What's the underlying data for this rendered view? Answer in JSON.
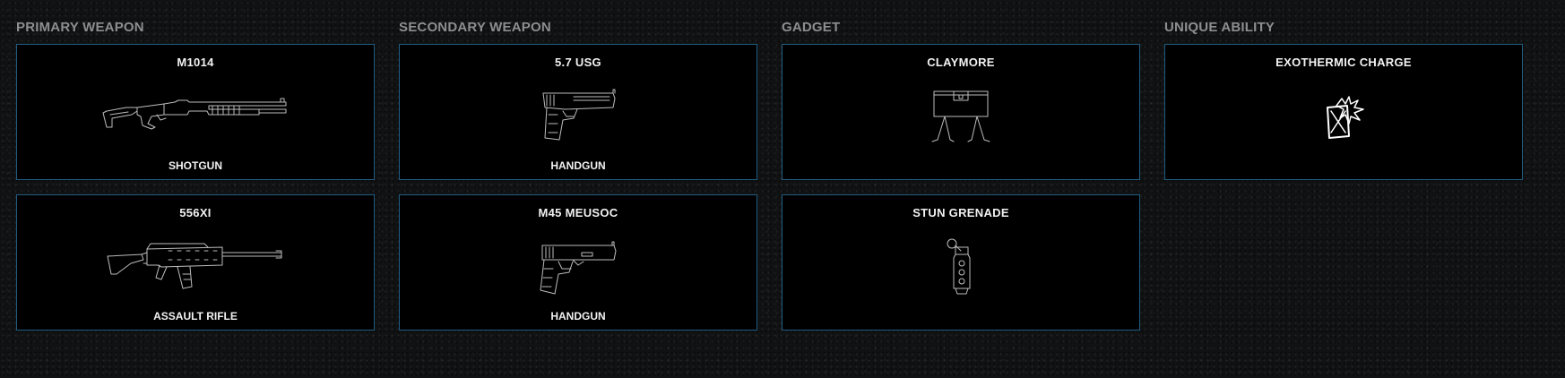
{
  "columns": {
    "primary": {
      "header": "PRIMARY WEAPON",
      "items": [
        {
          "name": "M1014",
          "type": "SHOTGUN",
          "icon": "shotgun-icon"
        },
        {
          "name": "556XI",
          "type": "ASSAULT RIFLE",
          "icon": "assault-rifle-icon"
        }
      ]
    },
    "secondary": {
      "header": "SECONDARY WEAPON",
      "items": [
        {
          "name": "5.7 USG",
          "type": "HANDGUN",
          "icon": "handgun-icon"
        },
        {
          "name": "M45 MEUSOC",
          "type": "HANDGUN",
          "icon": "pistol-icon"
        }
      ]
    },
    "gadget": {
      "header": "GADGET",
      "items": [
        {
          "name": "CLAYMORE",
          "icon": "claymore-icon"
        },
        {
          "name": "STUN GRENADE",
          "icon": "stun-grenade-icon"
        }
      ]
    },
    "unique": {
      "header": "UNIQUE ABILITY",
      "items": [
        {
          "name": "EXOTHERMIC CHARGE",
          "icon": "exothermic-charge-icon"
        }
      ]
    }
  },
  "colors": {
    "background": "#111213",
    "card_background": "#000000",
    "card_border": "#1f5d82",
    "header_text": "#8e8e91",
    "card_text": "#f2f2f2",
    "icon_stroke": "#bdbdbd"
  }
}
